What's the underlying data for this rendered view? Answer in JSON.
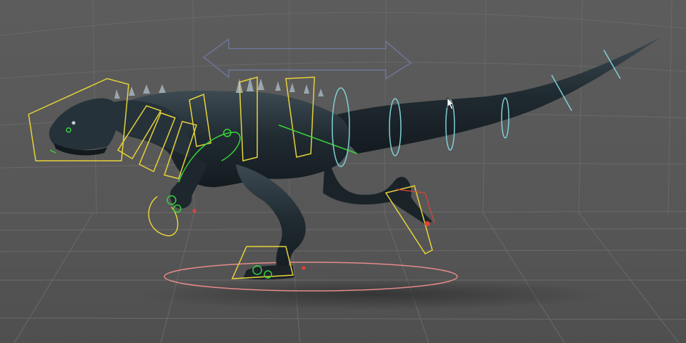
{
  "viewport": {
    "background_color": "#595959",
    "grid_color": "#6a6a6a",
    "floor_color": "#505050"
  },
  "character": {
    "name_icon": "raptor-dinosaur-model",
    "skin_color": "#1f2a30",
    "skin_highlight": "#4b5a63",
    "spike_color": "#9aa6ad"
  },
  "rig": {
    "fk_box_color": "#e6d23a",
    "torso_control_color": "#39d13a",
    "tail_ring_color": "#7fd0d6",
    "foot_ik_color": "#e0423a",
    "root_circle_color": "#e58a8a"
  },
  "gizmo": {
    "move_arrow_icon": "double-arrow-icon",
    "color": "#6e7598"
  },
  "cursor": {
    "icon": "mouse-pointer-icon"
  }
}
